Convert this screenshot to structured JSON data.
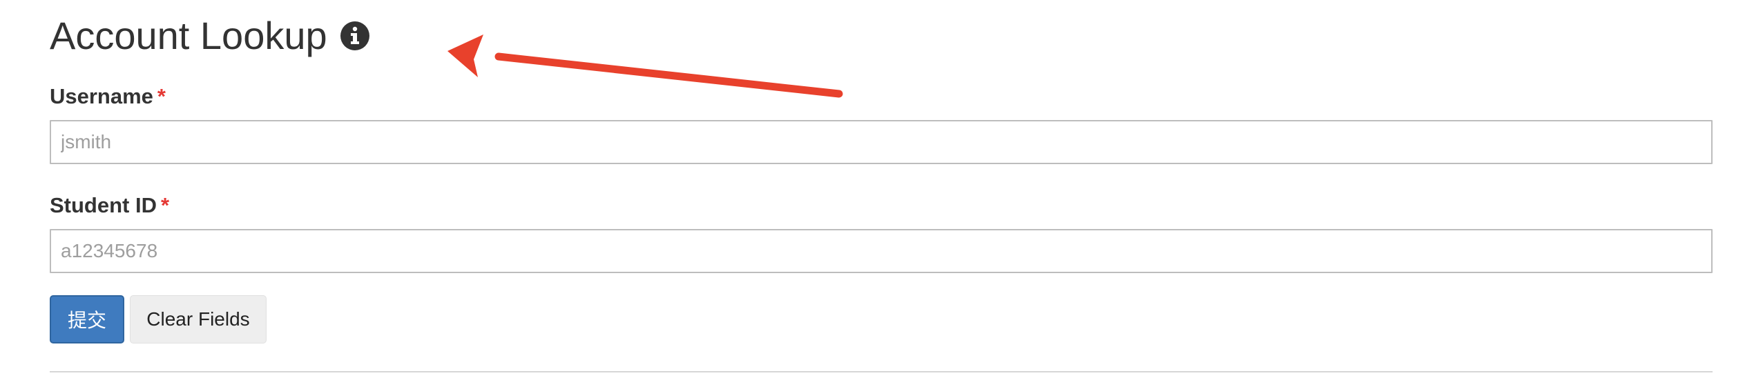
{
  "header": {
    "title": "Account Lookup",
    "info_icon": "info-circle-icon"
  },
  "form": {
    "username": {
      "label": "Username",
      "required_mark": "*",
      "value": "",
      "placeholder": "jsmith"
    },
    "student_id": {
      "label": "Student ID",
      "required_mark": "*",
      "value": "",
      "placeholder": "a12345678"
    },
    "buttons": {
      "submit_label": "提交",
      "clear_label": "Clear Fields"
    }
  },
  "colors": {
    "required": "#e53935",
    "primary_button": "#3f7bbf",
    "annotation_arrow": "#e8412c"
  }
}
